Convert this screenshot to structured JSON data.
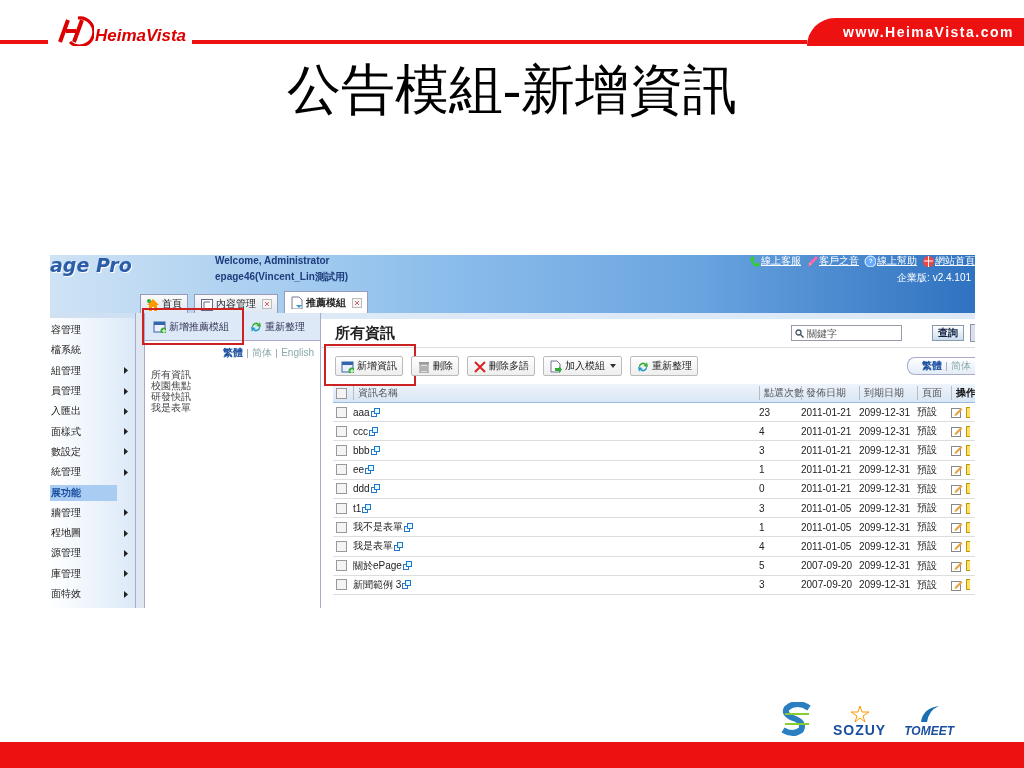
{
  "slide": {
    "logo_text": "HeimaVista",
    "url": "www.HeimaVista.com",
    "title": "公告模組-新增資訊",
    "footer_logos": [
      "SOZUY",
      "TOMEET"
    ]
  },
  "app": {
    "brand": "age Pro",
    "welcome": "Welcome, Administrator",
    "site": "epage46(Vincent_Lin測試用)",
    "top_links": [
      {
        "label": "線上客服",
        "kind": "phone"
      },
      {
        "label": "客戶之音",
        "kind": "pencil"
      },
      {
        "label": "線上幫助",
        "kind": "help"
      },
      {
        "label": "網站首頁",
        "kind": "globe"
      }
    ],
    "edition": "企業版: v2.4.101",
    "tabs": [
      {
        "label": "首頁",
        "kind": "home",
        "closable": false,
        "selected": false
      },
      {
        "label": "內容管理",
        "kind": "doc",
        "closable": true,
        "selected": false
      },
      {
        "label": "推薦模組",
        "kind": "module",
        "closable": true,
        "selected": true
      }
    ],
    "menu": [
      {
        "label": "容管理",
        "has_submenu": false,
        "selected": false
      },
      {
        "label": "檔系統",
        "has_submenu": false,
        "selected": false
      },
      {
        "label": "組管理",
        "has_submenu": true,
        "selected": false
      },
      {
        "label": "員管理",
        "has_submenu": true,
        "selected": false
      },
      {
        "label": "入匯出",
        "has_submenu": true,
        "selected": false
      },
      {
        "label": "面樣式",
        "has_submenu": true,
        "selected": false
      },
      {
        "label": "數設定",
        "has_submenu": true,
        "selected": false
      },
      {
        "label": "統管理",
        "has_submenu": true,
        "selected": false
      },
      {
        "label": "展功能",
        "has_submenu": false,
        "selected": true
      },
      {
        "label": "牆管理",
        "has_submenu": true,
        "selected": false
      },
      {
        "label": "程地圖",
        "has_submenu": true,
        "selected": false
      },
      {
        "label": "源管理",
        "has_submenu": true,
        "selected": false
      },
      {
        "label": "庫管理",
        "has_submenu": true,
        "selected": false
      },
      {
        "label": "面特效",
        "has_submenu": true,
        "selected": false
      }
    ],
    "left_panel": {
      "buttons": [
        {
          "label": "新增推薦模組",
          "kind": "add",
          "highlighted": true
        },
        {
          "label": "重新整理",
          "kind": "refresh",
          "highlighted": false
        }
      ],
      "languages": [
        {
          "label": "繁體",
          "selected": true
        },
        {
          "label": "简体",
          "selected": false
        },
        {
          "label": "English",
          "selected": false
        }
      ],
      "items": [
        "所有資訊",
        "校園焦點",
        "研發快訊",
        "我是表單"
      ]
    },
    "main": {
      "heading": "所有資訊",
      "search": {
        "placeholder": "關鍵字",
        "button": "查詢"
      },
      "toolbar": [
        {
          "label": "新增資訊",
          "kind": "add",
          "highlighted": true
        },
        {
          "label": "刪除",
          "kind": "trash",
          "highlighted": false
        },
        {
          "label": "刪除多語",
          "kind": "cross",
          "highlighted": false
        },
        {
          "label": "加入模組",
          "kind": "dropdown",
          "highlighted": false
        },
        {
          "label": "重新整理",
          "kind": "refresh",
          "highlighted": false
        }
      ],
      "languages": [
        {
          "label": "繁體",
          "selected": true
        },
        {
          "label": "简体",
          "selected": false
        }
      ],
      "table": {
        "all_checked": false,
        "columns": [
          "資訊名稱",
          "點選次數",
          "發佈日期",
          "到期日期",
          "頁面",
          "操作"
        ],
        "rows": [
          {
            "checked": false,
            "cells": [
              "aaa",
              "23",
              "2011-01-21",
              "2099-12-31",
              "預設"
            ]
          },
          {
            "checked": false,
            "cells": [
              "ccc",
              "4",
              "2011-01-21",
              "2099-12-31",
              "預設"
            ]
          },
          {
            "checked": false,
            "cells": [
              "bbb",
              "3",
              "2011-01-21",
              "2099-12-31",
              "預設"
            ]
          },
          {
            "checked": false,
            "cells": [
              "ee",
              "1",
              "2011-01-21",
              "2099-12-31",
              "預設"
            ]
          },
          {
            "checked": false,
            "cells": [
              "ddd",
              "0",
              "2011-01-21",
              "2099-12-31",
              "預設"
            ]
          },
          {
            "checked": false,
            "cells": [
              "t1",
              "3",
              "2011-01-05",
              "2099-12-31",
              "預設"
            ]
          },
          {
            "checked": false,
            "cells": [
              "我不是表單",
              "1",
              "2011-01-05",
              "2099-12-31",
              "預設"
            ]
          },
          {
            "checked": false,
            "cells": [
              "我是表單",
              "4",
              "2011-01-05",
              "2099-12-31",
              "預設"
            ]
          },
          {
            "checked": false,
            "cells": [
              "關於ePage",
              "5",
              "2007-09-20",
              "2099-12-31",
              "預設"
            ]
          },
          {
            "checked": false,
            "cells": [
              "新聞範例 3",
              "3",
              "2007-09-20",
              "2099-12-31",
              "預設"
            ]
          }
        ]
      }
    }
  }
}
